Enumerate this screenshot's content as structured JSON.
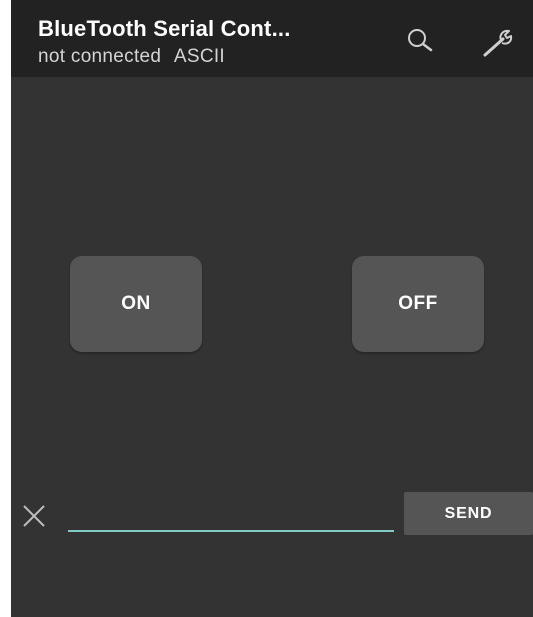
{
  "header": {
    "title": "BlueTooth Serial Cont...",
    "status": "not connected",
    "mode": "ASCII",
    "search_icon": "search-icon",
    "settings_icon": "wrench-icon"
  },
  "pad": {
    "on_label": "ON",
    "off_label": "OFF"
  },
  "terminal": {
    "clear_icon": "close-icon",
    "input_value": "",
    "send_label": "SEND",
    "accent_color": "#80cbc4"
  },
  "colors": {
    "background": "#333333",
    "action_bar": "#222222",
    "button": "#555555"
  }
}
